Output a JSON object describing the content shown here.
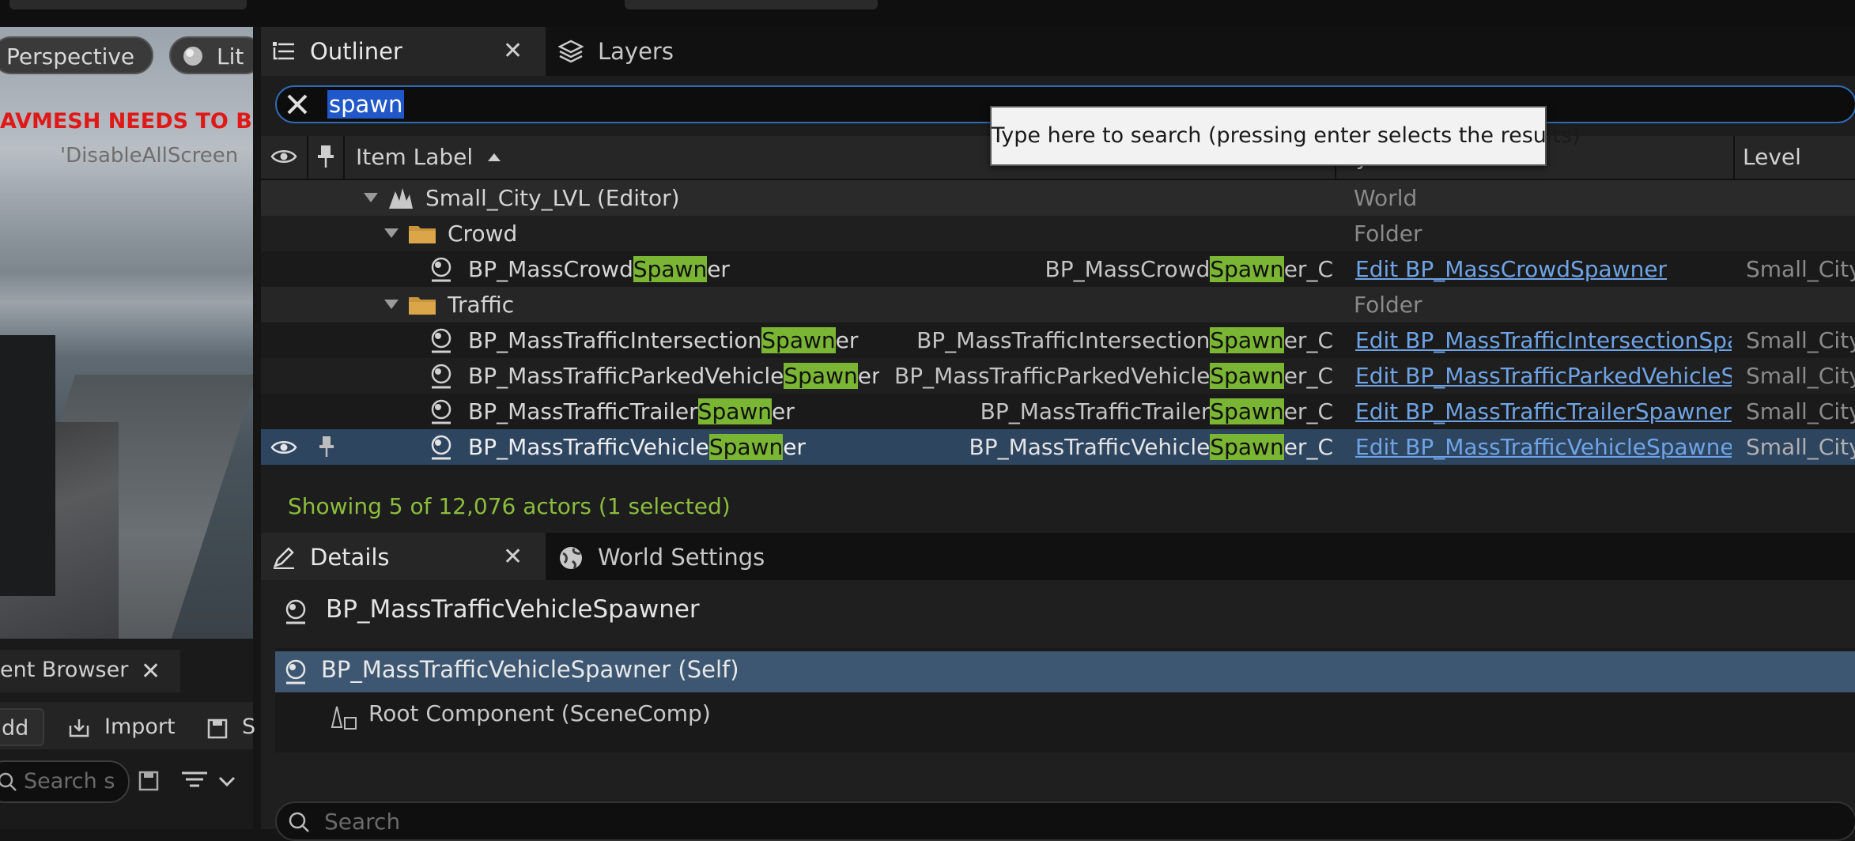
{
  "viewport": {
    "perspective_label": "Perspective",
    "lit_label": "Lit",
    "warning_text": "AVMESH NEEDS TO BE R",
    "overlay_text": "'DisableAllScreen"
  },
  "content_browser": {
    "tab_label": "ent Browser",
    "add_label": "dd",
    "import_label": "Import",
    "save_label": "S",
    "search_placeholder": "Search s"
  },
  "outliner": {
    "tab_label": "Outliner",
    "layers_tab_label": "Layers",
    "search_value": "spawn",
    "tooltip": "Type here to search (pressing enter selects the results)",
    "columns": {
      "label": "Item Label",
      "type": "Ty",
      "level": "Level"
    },
    "rows": [
      {
        "label": "Small_City_LVL (Editor)",
        "type": "World",
        "kind": "world"
      },
      {
        "label": "Crowd",
        "type": "Folder",
        "kind": "folder"
      },
      {
        "label_pre": "BP_MassCrowd",
        "label_hl": "Spawn",
        "label_post": "er",
        "type_pre": "BP_MassCrowd",
        "type_hl": "Spawn",
        "type_post": "er_C",
        "link": "Edit BP_MassCrowdSpawner",
        "level": "Small_City",
        "kind": "actor"
      },
      {
        "label": "Traffic",
        "type": "Folder",
        "kind": "folder"
      },
      {
        "label_pre": "BP_MassTrafficIntersection",
        "label_hl": "Spawn",
        "label_post": "er",
        "type_pre": "BP_MassTrafficIntersection",
        "type_hl": "Spawn",
        "type_post": "er_C",
        "link": "Edit BP_MassTrafficIntersectionSpa",
        "level": "Small_City",
        "kind": "actor"
      },
      {
        "label_pre": "BP_MassTrafficParkedVehicle",
        "label_hl": "Spawn",
        "label_post": "er",
        "type_pre": "BP_MassTrafficParkedVehicle",
        "type_hl": "Spawn",
        "type_post": "er_C",
        "link": "Edit BP_MassTrafficParkedVehicleS",
        "level": "Small_City",
        "kind": "actor"
      },
      {
        "label_pre": "BP_MassTrafficTrailer",
        "label_hl": "Spawn",
        "label_post": "er",
        "type_pre": "BP_MassTrafficTrailer",
        "type_hl": "Spawn",
        "type_post": "er_C",
        "link": "Edit BP_MassTrafficTrailerSpawner",
        "level": "Small_City",
        "kind": "actor"
      },
      {
        "label_pre": "BP_MassTrafficVehicle",
        "label_hl": "Spawn",
        "label_post": "er",
        "type_pre": "BP_MassTrafficVehicle",
        "type_hl": "Spawn",
        "type_post": "er_C",
        "link": "Edit BP_MassTrafficVehicleSpawne",
        "level": "Small_City",
        "kind": "actor",
        "selected": true
      }
    ],
    "status": "Showing 5 of 12,076 actors (1 selected)"
  },
  "details": {
    "tab_label": "Details",
    "world_settings_tab_label": "World Settings",
    "title": "BP_MassTrafficVehicleSpawner",
    "self_component": "BP_MassTrafficVehicleSpawner (Self)",
    "root_component": "Root Component (SceneComp)",
    "search_placeholder": "Search"
  },
  "colors": {
    "highlight": "#7ab534",
    "search_border": "#2f6bb5",
    "selected_row": "#2e4560",
    "status_text": "#8bbd3d",
    "link": "#6ea4e6"
  }
}
